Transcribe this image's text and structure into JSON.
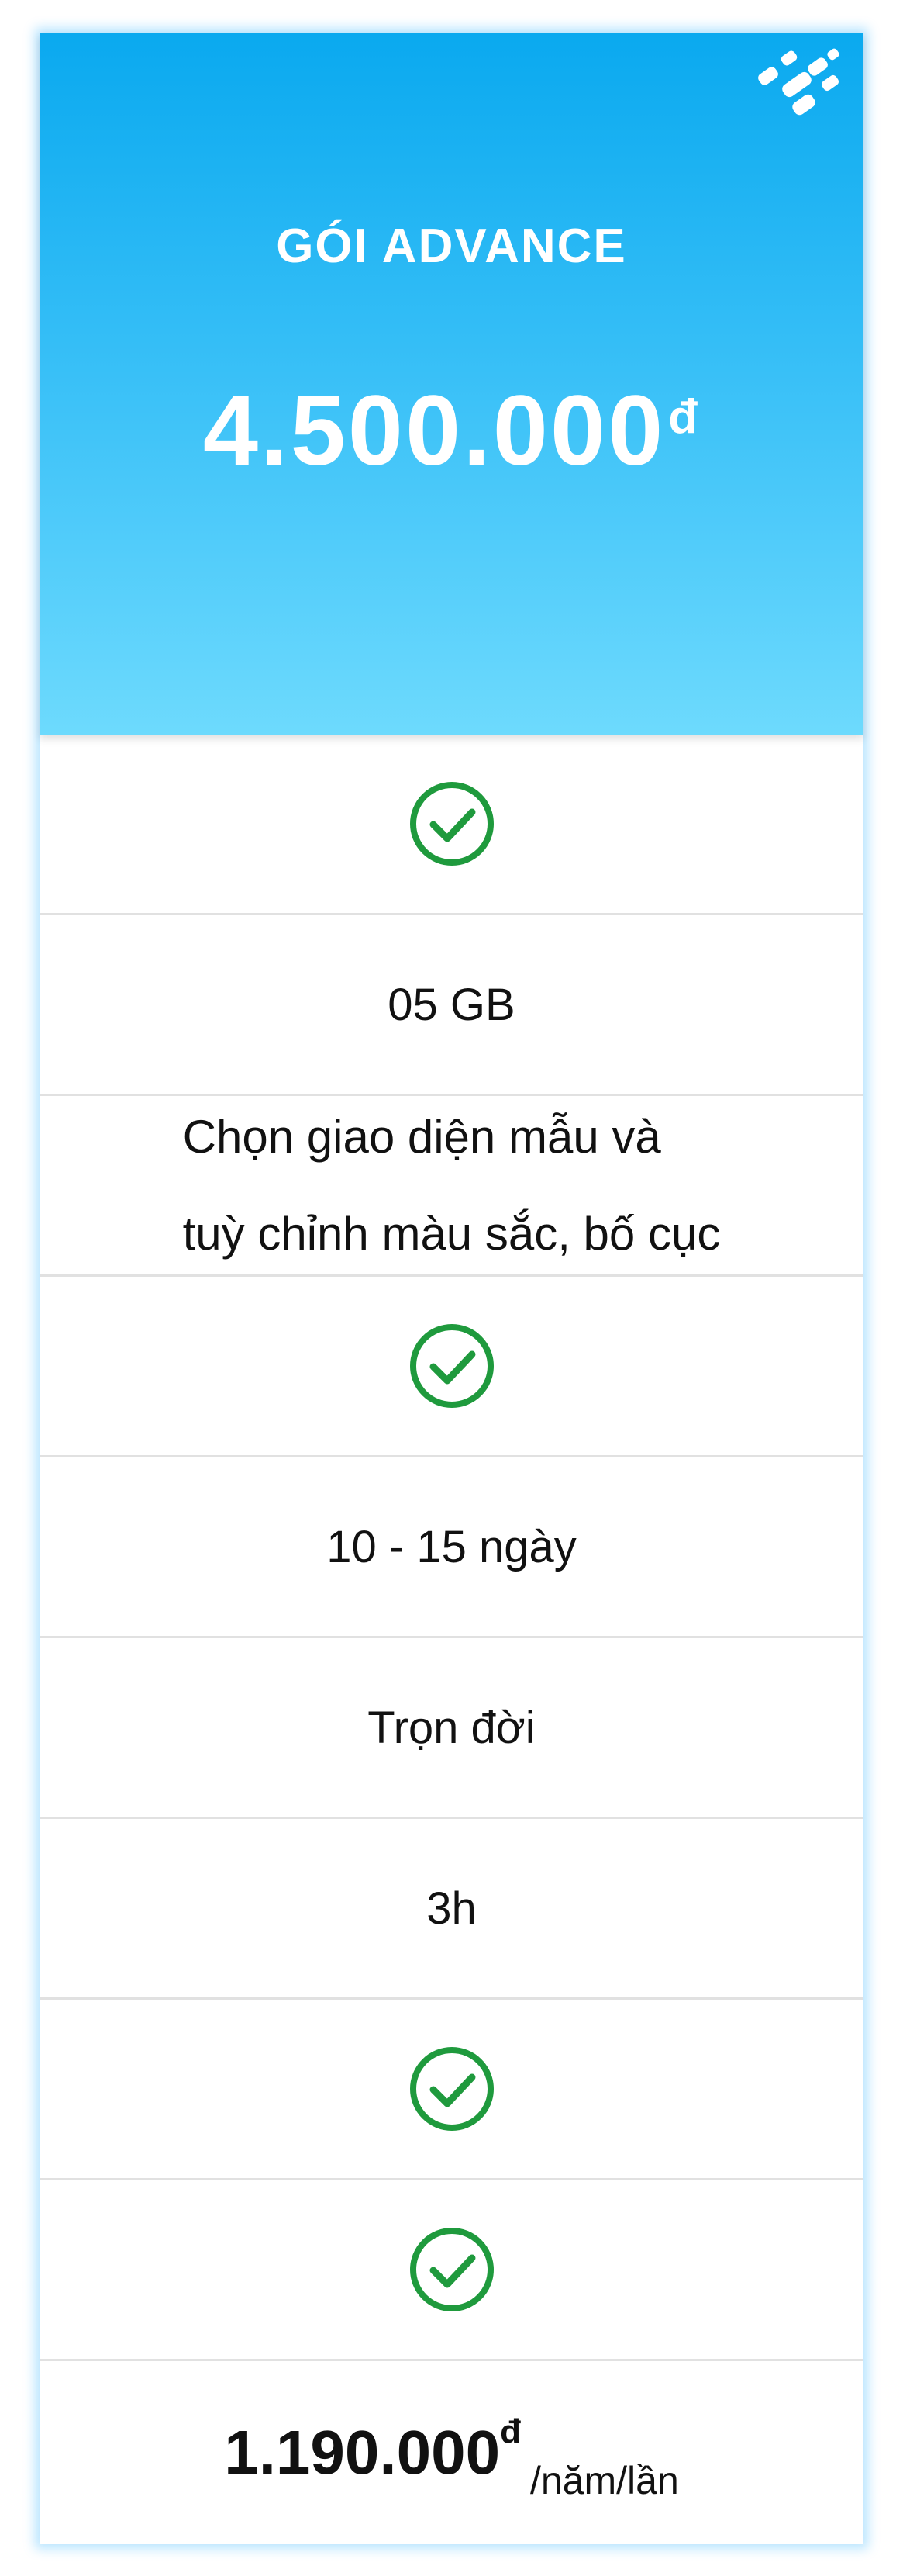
{
  "plan": {
    "name": "GÓI ADVANCE",
    "price": "4.500.000",
    "currency": "đ"
  },
  "features": [
    {
      "type": "check",
      "icon": "check-circle-icon"
    },
    {
      "type": "text",
      "value": "05 GB"
    },
    {
      "type": "text",
      "lines": [
        "Chọn giao diện mẫu và",
        "tuỳ chỉnh màu sắc, bố cục"
      ]
    },
    {
      "type": "check",
      "icon": "check-circle-icon"
    },
    {
      "type": "text",
      "value": "10 - 15 ngày"
    },
    {
      "type": "text",
      "value": "Trọn đời"
    },
    {
      "type": "text",
      "value": "3h"
    },
    {
      "type": "check",
      "icon": "check-circle-icon"
    },
    {
      "type": "check",
      "icon": "check-circle-icon"
    }
  ],
  "renewal": {
    "price": "1.190.000",
    "currency": "đ",
    "unit": "/năm/lần"
  },
  "colors": {
    "header_top": "#0aa9ef",
    "header_bottom": "#6ddafd",
    "check_green": "#1f9a3d",
    "divider": "#e1e1e1"
  }
}
